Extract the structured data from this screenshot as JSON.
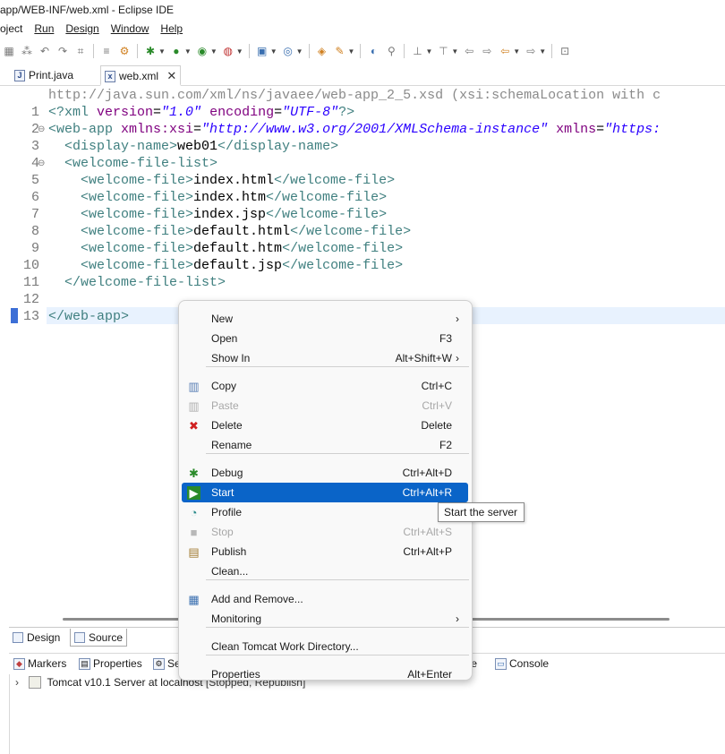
{
  "window": {
    "title": "app/WEB-INF/web.xml - Eclipse IDE"
  },
  "menubar": {
    "items": [
      "oject",
      "Run",
      "Design",
      "Window",
      "Help"
    ]
  },
  "toolbar": {
    "icons": [
      "save-all-icon",
      "new-icon",
      "undo-icon",
      "redo-icon",
      "toggle-icon",
      "format-icon",
      "build-icon",
      "debug-icon",
      "run-icon",
      "coverage-icon",
      "external-tools-icon",
      "new-server-icon",
      "open-type-icon",
      "search-icon",
      "next-annotation-icon",
      "prev-annotation-icon",
      "last-edit-icon",
      "back-icon",
      "forward-icon",
      "pin-icon"
    ]
  },
  "editor_tabs": [
    {
      "label": "Print.java",
      "icon": "java-file-icon"
    },
    {
      "label": "web.xml",
      "icon": "xml-file-icon"
    }
  ],
  "editor": {
    "schema_hint": "http://java.sun.com/xml/ns/javaee/web-app_2_5.xsd (xsi:schemaLocation with c",
    "lines": [
      {
        "num": "1",
        "fold": "",
        "segments": [
          {
            "cls": "pi",
            "t": "<?xml "
          },
          {
            "cls": "attr",
            "t": "version"
          },
          {
            "cls": "txt",
            "t": "="
          },
          {
            "cls": "val",
            "t": "\"1.0\""
          },
          {
            "cls": "txt",
            "t": " "
          },
          {
            "cls": "attr",
            "t": "encoding"
          },
          {
            "cls": "txt",
            "t": "="
          },
          {
            "cls": "val",
            "t": "\"UTF-8\""
          },
          {
            "cls": "pi",
            "t": "?>"
          }
        ]
      },
      {
        "num": "2",
        "fold": "⊖",
        "segments": [
          {
            "cls": "tagc",
            "t": "<web-app "
          },
          {
            "cls": "attr",
            "t": "xmlns:xsi"
          },
          {
            "cls": "txt",
            "t": "="
          },
          {
            "cls": "val",
            "t": "\"http://www.w3.org/2001/XMLSchema-instance\""
          },
          {
            "cls": "txt",
            "t": " "
          },
          {
            "cls": "attr",
            "t": "xmlns"
          },
          {
            "cls": "txt",
            "t": "="
          },
          {
            "cls": "val",
            "t": "\"https:"
          }
        ]
      },
      {
        "num": "3",
        "fold": "",
        "segments": [
          {
            "cls": "tagc",
            "t": "  <display-name>"
          },
          {
            "cls": "txt",
            "t": "web01"
          },
          {
            "cls": "tagc",
            "t": "</display-name>"
          }
        ]
      },
      {
        "num": "4",
        "fold": "⊖",
        "segments": [
          {
            "cls": "tagc",
            "t": "  <welcome-file-list>"
          }
        ]
      },
      {
        "num": "5",
        "fold": "",
        "segments": [
          {
            "cls": "tagc",
            "t": "    <welcome-file>"
          },
          {
            "cls": "txt",
            "t": "index.html"
          },
          {
            "cls": "tagc",
            "t": "</welcome-file>"
          }
        ]
      },
      {
        "num": "6",
        "fold": "",
        "segments": [
          {
            "cls": "tagc",
            "t": "    <welcome-file>"
          },
          {
            "cls": "txt",
            "t": "index.htm"
          },
          {
            "cls": "tagc",
            "t": "</welcome-file>"
          }
        ]
      },
      {
        "num": "7",
        "fold": "",
        "segments": [
          {
            "cls": "tagc",
            "t": "    <welcome-file>"
          },
          {
            "cls": "txt",
            "t": "index.jsp"
          },
          {
            "cls": "tagc",
            "t": "</welcome-file>"
          }
        ]
      },
      {
        "num": "8",
        "fold": "",
        "segments": [
          {
            "cls": "tagc",
            "t": "    <welcome-file>"
          },
          {
            "cls": "txt",
            "t": "default.html"
          },
          {
            "cls": "tagc",
            "t": "</welcome-file>"
          }
        ]
      },
      {
        "num": "9",
        "fold": "",
        "segments": [
          {
            "cls": "tagc",
            "t": "    <welcome-file>"
          },
          {
            "cls": "txt",
            "t": "default.htm"
          },
          {
            "cls": "tagc",
            "t": "</welcome-file>"
          }
        ]
      },
      {
        "num": "10",
        "fold": "",
        "segments": [
          {
            "cls": "tagc",
            "t": "    <welcome-file>"
          },
          {
            "cls": "txt",
            "t": "default.jsp"
          },
          {
            "cls": "tagc",
            "t": "</welcome-file>"
          }
        ]
      },
      {
        "num": "11",
        "fold": "",
        "segments": [
          {
            "cls": "tagc",
            "t": "  </welcome-file-list>"
          }
        ]
      },
      {
        "num": "12",
        "fold": "",
        "segments": []
      },
      {
        "num": "13",
        "fold": "",
        "segments": [
          {
            "cls": "tagc",
            "t": "</web-app>"
          }
        ]
      }
    ]
  },
  "design_tabs": {
    "design": "Design",
    "source": "Source"
  },
  "bottom_views": {
    "markers": "Markers",
    "properties": "Properties",
    "servers": "Se",
    "snippets": "ole",
    "console": "Console"
  },
  "servers": {
    "row": "Tomcat v10.1 Server at localhost",
    "status": "[Stopped, Republish]"
  },
  "context_menu": {
    "items": [
      {
        "label": "New",
        "key": "",
        "arrow": true,
        "icon": "",
        "disabled": false,
        "selected": false
      },
      {
        "label": "Open",
        "key": "F3",
        "arrow": false,
        "icon": "",
        "disabled": false,
        "selected": false
      },
      {
        "label": "Show In",
        "key": "Alt+Shift+W",
        "arrow": true,
        "icon": "",
        "disabled": false,
        "selected": false
      },
      {
        "label": "Copy",
        "key": "Ctrl+C",
        "arrow": false,
        "icon": "copy-icon",
        "disabled": false,
        "selected": false
      },
      {
        "label": "Paste",
        "key": "Ctrl+V",
        "arrow": false,
        "icon": "paste-icon",
        "disabled": true,
        "selected": false
      },
      {
        "label": "Delete",
        "key": "Delete",
        "arrow": false,
        "icon": "delete-icon",
        "disabled": false,
        "selected": false
      },
      {
        "label": "Rename",
        "key": "F2",
        "arrow": false,
        "icon": "",
        "disabled": false,
        "selected": false
      },
      {
        "label": "Debug",
        "key": "Ctrl+Alt+D",
        "arrow": false,
        "icon": "debug-icon",
        "disabled": false,
        "selected": false
      },
      {
        "label": "Start",
        "key": "Ctrl+Alt+R",
        "arrow": false,
        "icon": "start-icon",
        "disabled": false,
        "selected": true
      },
      {
        "label": "Profile",
        "key": "",
        "arrow": false,
        "icon": "profile-icon",
        "disabled": false,
        "selected": false
      },
      {
        "label": "Stop",
        "key": "Ctrl+Alt+S",
        "arrow": false,
        "icon": "stop-icon",
        "disabled": true,
        "selected": false
      },
      {
        "label": "Publish",
        "key": "Ctrl+Alt+P",
        "arrow": false,
        "icon": "publish-icon",
        "disabled": false,
        "selected": false
      },
      {
        "label": "Clean...",
        "key": "",
        "arrow": false,
        "icon": "",
        "disabled": false,
        "selected": false
      },
      {
        "label": "Add and Remove...",
        "key": "",
        "arrow": false,
        "icon": "add-remove-icon",
        "disabled": false,
        "selected": false
      },
      {
        "label": "Monitoring",
        "key": "",
        "arrow": true,
        "icon": "",
        "disabled": false,
        "selected": false
      },
      {
        "label": "Clean Tomcat Work Directory...",
        "key": "",
        "arrow": false,
        "icon": "",
        "disabled": false,
        "selected": false
      },
      {
        "label": "Properties",
        "key": "Alt+Enter",
        "arrow": false,
        "icon": "",
        "disabled": false,
        "selected": false
      }
    ]
  },
  "tooltip": {
    "text": "Start the server"
  }
}
